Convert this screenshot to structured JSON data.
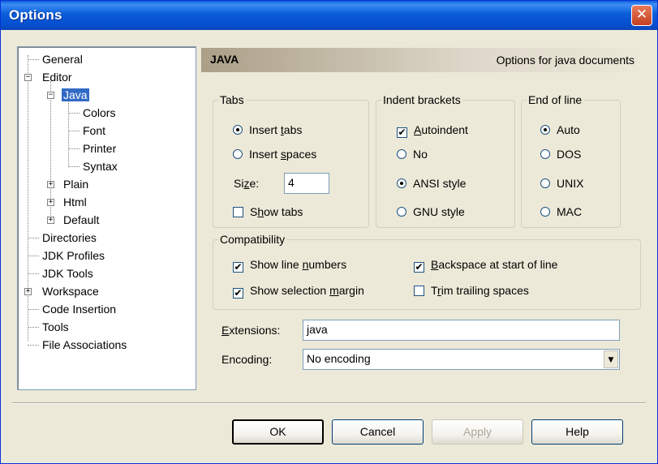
{
  "window": {
    "title": "Options",
    "close_glyph": "✕"
  },
  "tree": {
    "items": [
      {
        "label": "General"
      },
      {
        "label": "Editor",
        "expander": "−"
      },
      {
        "label": "Java",
        "expander": "−"
      },
      {
        "label": "Colors"
      },
      {
        "label": "Font"
      },
      {
        "label": "Printer"
      },
      {
        "label": "Syntax"
      },
      {
        "label": "Plain",
        "expander": "+"
      },
      {
        "label": "Html",
        "expander": "+"
      },
      {
        "label": "Default",
        "expander": "+"
      },
      {
        "label": "Directories"
      },
      {
        "label": "JDK Profiles"
      },
      {
        "label": "JDK Tools"
      },
      {
        "label": "Workspace",
        "expander": "+"
      },
      {
        "label": "Code Insertion"
      },
      {
        "label": "Tools"
      },
      {
        "label": "File Associations"
      }
    ]
  },
  "header": {
    "title": "JAVA",
    "description": "Options for java documents"
  },
  "tabs_group": {
    "legend": "Tabs",
    "insert_tabs": {
      "pre": "Insert ",
      "key": "t",
      "post": "abs",
      "selected": true
    },
    "insert_spaces": {
      "pre": "Insert ",
      "key": "s",
      "post": "paces",
      "selected": false
    },
    "size_label": {
      "pre": "Si",
      "key": "z",
      "post": "e:"
    },
    "size_value": "4",
    "show_tabs": {
      "pre": "S",
      "key": "h",
      "post": "ow tabs",
      "checked": false
    }
  },
  "indent_group": {
    "legend": "Indent brackets",
    "autoindent": {
      "pre": "",
      "key": "A",
      "post": "utoindent",
      "checked": true
    },
    "no": {
      "label": "No",
      "selected": false
    },
    "ansi": {
      "label": "ANSI style",
      "selected": true
    },
    "gnu": {
      "label": "GNU style",
      "selected": false
    }
  },
  "eol_group": {
    "legend": "End of line",
    "auto": {
      "label": "Auto",
      "selected": true
    },
    "dos": {
      "label": "DOS",
      "selected": false
    },
    "unix": {
      "label": "UNIX",
      "selected": false
    },
    "mac": {
      "label": "MAC",
      "selected": false
    }
  },
  "compat_group": {
    "legend": "Compatibility",
    "show_line_numbers": {
      "pre": "Show line ",
      "key": "n",
      "post": "umbers",
      "checked": true
    },
    "show_selection_margin": {
      "pre": "Show selection ",
      "key": "m",
      "post": "argin",
      "checked": true
    },
    "backspace_start": {
      "pre": "",
      "key": "B",
      "post": "ackspace at start of line",
      "checked": true
    },
    "trim_trailing": {
      "pre": "T",
      "key": "r",
      "post": "im trailing spaces",
      "checked": false
    }
  },
  "extensions": {
    "pre": "",
    "key": "E",
    "post": "xtensions:",
    "value": "java"
  },
  "encoding": {
    "pre": "Encodin",
    "key": "g",
    "post": ":",
    "value": "No encoding"
  },
  "buttons": {
    "ok": "OK",
    "cancel": "Cancel",
    "apply": "Apply",
    "help": "Help"
  },
  "glyphs": {
    "check": "✔",
    "dropdown": "▼"
  }
}
